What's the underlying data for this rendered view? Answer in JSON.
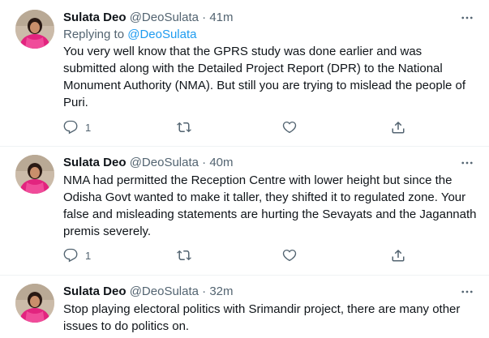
{
  "tweets": [
    {
      "name": "Sulata Deo",
      "handle": "@DeoSulata",
      "sep": "·",
      "time": "41m",
      "reply_prefix": "Replying to ",
      "reply_to": "@DeoSulata",
      "text": "You very well know that the GPRS study was done earlier and was submitted along with the Detailed Project Report (DPR) to the National Monument Authority (NMA). But still you are trying to mislead the people of Puri.",
      "reply_count": "1",
      "retweet_count": "",
      "like_count": ""
    },
    {
      "name": "Sulata Deo",
      "handle": "@DeoSulata",
      "sep": "·",
      "time": "40m",
      "text": "NMA had permitted the Reception Centre with lower height but since the Odisha Govt wanted to make it taller, they shifted it to regulated zone. Your false and misleading statements are hurting the Sevayats and the Jagannath premis severely.",
      "reply_count": "1",
      "retweet_count": "",
      "like_count": ""
    },
    {
      "name": "Sulata Deo",
      "handle": "@DeoSulata",
      "sep": "·",
      "time": "32m",
      "text": "Stop playing electoral politics with Srimandir project, there are many other issues to do politics on."
    }
  ],
  "icons": {
    "reply": "reply-icon",
    "retweet": "retweet-icon",
    "like": "heart-icon",
    "share": "share-icon",
    "more": "more-icon"
  },
  "colors": {
    "text": "#0f1419",
    "secondary": "#536471",
    "link": "#1d9bf0",
    "divider": "#eff3f4"
  }
}
